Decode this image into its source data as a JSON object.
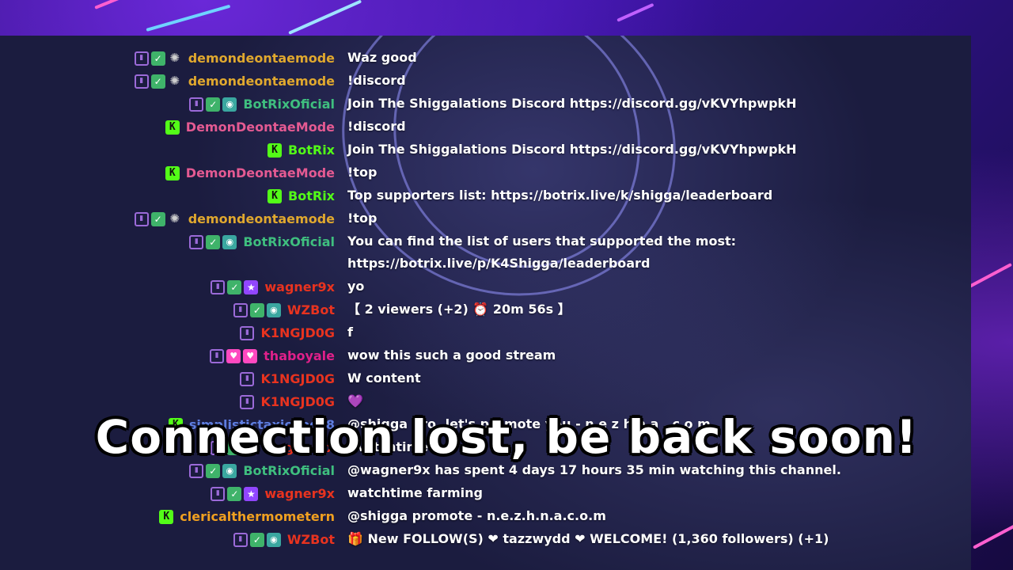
{
  "overlay": {
    "text": "Connection lost, be back soon!"
  },
  "colors": {
    "gold": "#e0a82e",
    "green": "#3fbf7f",
    "pink": "#e45a92",
    "kickgreen": "#53fc18",
    "red": "#e8331f",
    "magenta": "#e0208a",
    "blue": "#5e7ee0",
    "orange": "#f0a020"
  },
  "messages": [
    {
      "badges": [
        "twitch-icon",
        "green-check-icon",
        "grey-dragon-icon"
      ],
      "user": "demondeontaemode",
      "color": "#e0a82e",
      "text": "Waz good"
    },
    {
      "badges": [
        "twitch-icon",
        "green-check-icon",
        "grey-dragon-icon"
      ],
      "user": "demondeontaemode",
      "color": "#e0a82e",
      "text": "!discord"
    },
    {
      "badges": [
        "twitch-icon",
        "green-check-icon",
        "bot-icon"
      ],
      "user": "BotRixOficial",
      "color": "#3fbf7f",
      "text": "Join The Shiggalations Discord https://discord.gg/vKVYhpwpkH"
    },
    {
      "badges": [
        "kick-icon"
      ],
      "user": "DemonDeontaeMode",
      "color": "#e45a92",
      "text": "!discord"
    },
    {
      "badges": [
        "kick-icon"
      ],
      "user": "BotRix",
      "color": "#53fc18",
      "text": "Join The Shiggalations Discord https://discord.gg/vKVYhpwpkH"
    },
    {
      "badges": [
        "kick-icon"
      ],
      "user": "DemonDeontaeMode",
      "color": "#e45a92",
      "text": "!top"
    },
    {
      "badges": [
        "kick-icon"
      ],
      "user": "BotRix",
      "color": "#53fc18",
      "text": "Top supporters list: https://botrix.live/k/shigga/leaderboard"
    },
    {
      "badges": [
        "twitch-icon",
        "green-check-icon",
        "grey-dragon-icon"
      ],
      "user": "demondeontaemode",
      "color": "#e0a82e",
      "text": "!top"
    },
    {
      "badges": [
        "twitch-icon",
        "green-check-icon",
        "bot-icon"
      ],
      "user": "BotRixOficial",
      "color": "#3fbf7f",
      "text": "You can find the list of users that supported the most: https://botrix.live/p/K4Shigga/leaderboard",
      "tall": true
    },
    {
      "badges": [
        "twitch-icon",
        "green-check-icon",
        "star-icon"
      ],
      "user": "wagner9x",
      "color": "#e8331f",
      "text": "yo"
    },
    {
      "badges": [
        "twitch-icon",
        "green-check-icon",
        "bot-icon"
      ],
      "user": "WZBot",
      "color": "#e8331f",
      "text": "【 2 viewers (+2) ⏰ 20m 56s 】"
    },
    {
      "badges": [
        "twitch-icon"
      ],
      "user": "K1NGJD0G",
      "color": "#e8331f",
      "text": "f"
    },
    {
      "badges": [
        "twitch-icon",
        "heart-icon",
        "heart-icon"
      ],
      "user": "thaboyale",
      "color": "#e0208a",
      "text": "wow this such a good stream"
    },
    {
      "badges": [
        "twitch-icon"
      ],
      "user": "K1NGJD0G",
      "color": "#e8331f",
      "text": "W content"
    },
    {
      "badges": [
        "twitch-icon"
      ],
      "user": "K1NGJD0G",
      "color": "#e8331f",
      "text": "💜"
    },
    {
      "badges": [
        "kick-icon"
      ],
      "user": "simplistictaxicabgz8",
      "color": "#5e7ee0",
      "text": "@shigga bro, let's promote you - n e z h n a . c o m"
    },
    {
      "badges": [
        "twitch-icon",
        "green-check-icon",
        "star-icon"
      ],
      "user": "wagner9x",
      "color": "#e8331f",
      "text": "!watchtime"
    },
    {
      "badges": [
        "twitch-icon",
        "green-check-icon",
        "bot-icon"
      ],
      "user": "BotRixOficial",
      "color": "#3fbf7f",
      "text": "@wagner9x has spent 4 days 17 hours 35 min watching this channel."
    },
    {
      "badges": [
        "twitch-icon",
        "green-check-icon",
        "star-icon"
      ],
      "user": "wagner9x",
      "color": "#e8331f",
      "text": "watchtime farming"
    },
    {
      "badges": [
        "kick-icon"
      ],
      "user": "clericalthermometern",
      "color": "#f0a020",
      "text": "@shigga promote - n.e.z.h.n.a.c.o.m"
    },
    {
      "badges": [
        "twitch-icon",
        "green-check-icon",
        "bot-icon"
      ],
      "user": "WZBot",
      "color": "#e8331f",
      "text": "🎁 New FOLLOW(S) ❤ tazzwydd ❤  WELCOME! (1,360 followers) (+1)"
    }
  ]
}
